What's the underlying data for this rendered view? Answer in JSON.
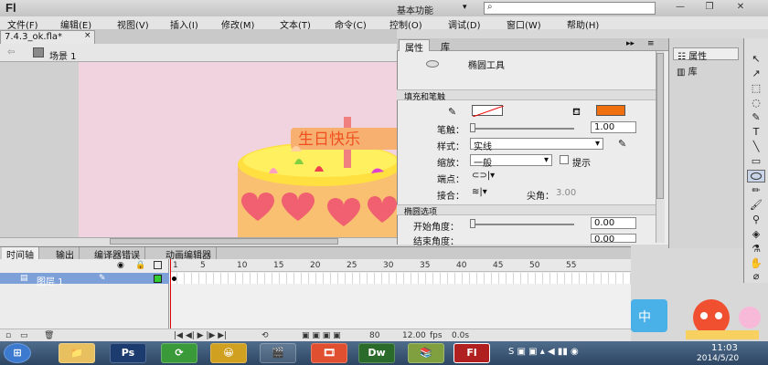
{
  "app": {
    "logo": "Fl",
    "workspace": "基本功能",
    "workspace_arrow": "▾",
    "search_icon": "⌕",
    "min": "—",
    "restore": "❐",
    "close": "✕"
  },
  "menu": [
    "文件(F)",
    "编辑(E)",
    "视图(V)",
    "插入(I)",
    "修改(M)",
    "文本(T)",
    "命令(C)",
    "控制(O)",
    "调试(D)",
    "窗口(W)",
    "帮助(H)"
  ],
  "doc": {
    "tab": "7.4.3_ok.fla*",
    "tab_close": "×",
    "scene": "场景 1",
    "back_icon": "⇦"
  },
  "stage": {
    "banner_text": "生日快乐",
    "background": "#f1d2df"
  },
  "props": {
    "tab_props": "属性",
    "tab_library": "库",
    "tool_name": "椭圆工具",
    "section_fill": "填充和笔触",
    "stroke_label": "笔触：",
    "stroke_value": "1.00",
    "style_label": "样式：",
    "style_value": "实线",
    "scale_label": "缩放：",
    "scale_value": "一般",
    "hint_label": "提示",
    "cap_label": "端点：",
    "join_label": "接合：",
    "miter_label": "尖角：",
    "miter_value": "3.00",
    "section_oval": "椭圆选项",
    "start_angle_label": "开始角度：",
    "start_angle_value": "0.00",
    "end_angle_label": "结束角度：",
    "end_angle_value": "0.00",
    "fill_color": "#f07010"
  },
  "dock": {
    "props_label": "属性",
    "lib_label": "库"
  },
  "tools": [
    "↖",
    "↗",
    "⬚",
    "◌",
    "✎",
    "T",
    "╲",
    "▭",
    "✏",
    "🖌",
    "⚲",
    "✋",
    "◈",
    "⌀",
    "⚗",
    "🔍"
  ],
  "timeline": {
    "tabs": [
      "时间轴",
      "输出",
      "编译器错误",
      "动画编辑器"
    ],
    "layer_name": "图层 1",
    "frame_numbers": [
      "1",
      "5",
      "10",
      "15",
      "20",
      "25",
      "30",
      "35",
      "40",
      "45",
      "50",
      "55"
    ],
    "fps": "12.00",
    "fps_unit": "fps",
    "time": "0.0s",
    "frame": "80"
  },
  "taskbar": {
    "apps": [
      "⊞",
      "📁",
      "Ps",
      "⟳",
      "😀",
      "🎬",
      "🎞",
      "Dw",
      "📚",
      "Fl"
    ],
    "time": "11:03",
    "date": "2014/5/20",
    "ime": "中"
  }
}
